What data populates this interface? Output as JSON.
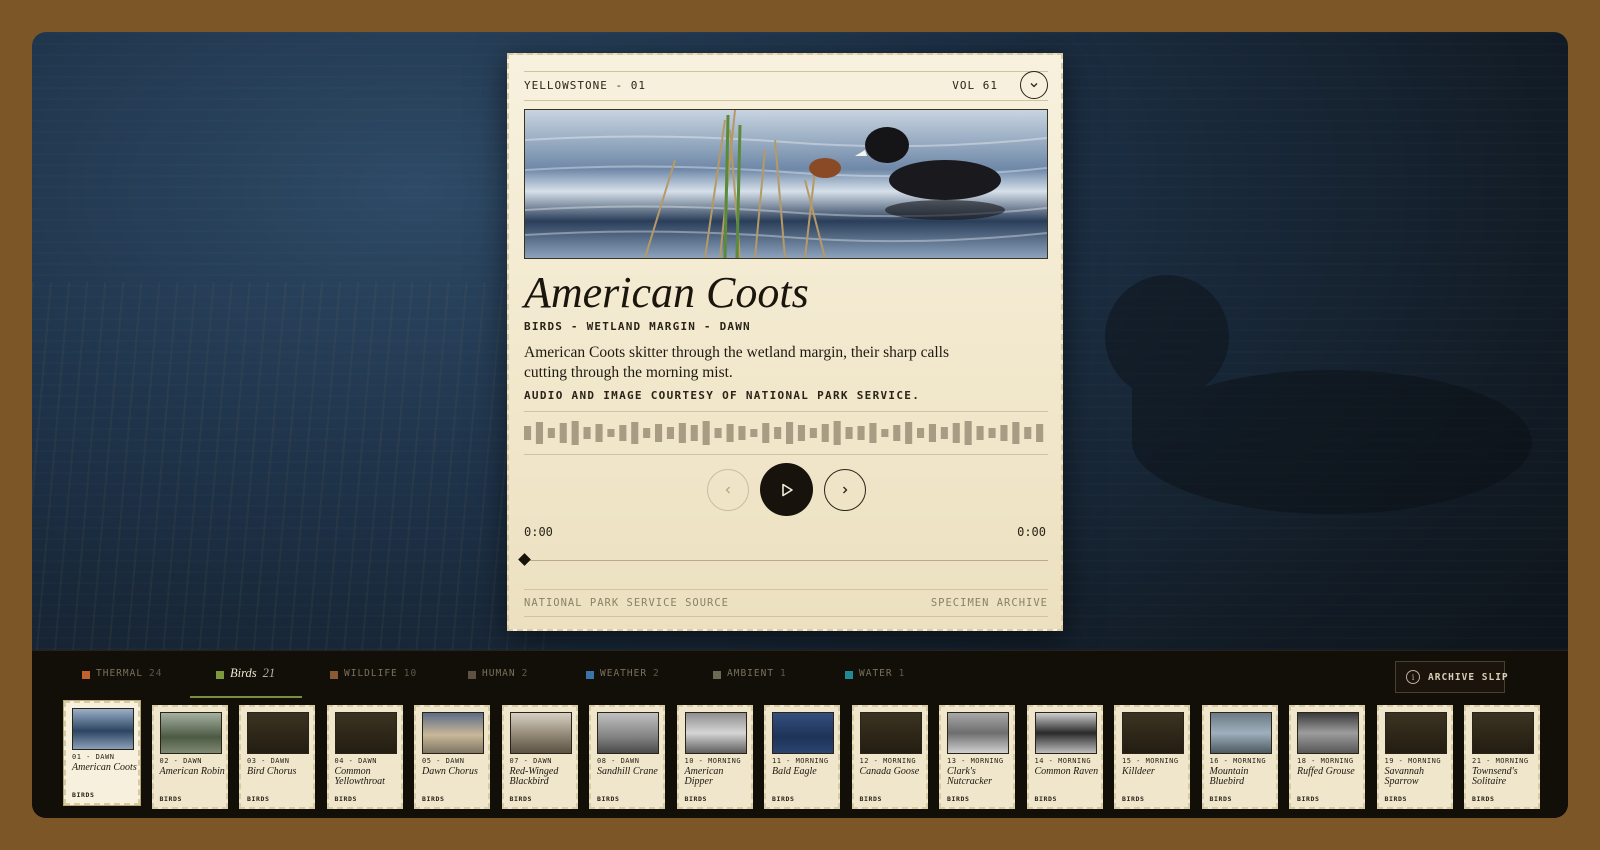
{
  "card": {
    "series": "YELLOWSTONE - 01",
    "volume": "VOL 61",
    "title": "American Coots",
    "meta": "BIRDS - WETLAND MARGIN - DAWN",
    "description": "American Coots skitter through the wetland margin, their sharp calls cutting through the morning mist.",
    "credit": "AUDIO AND IMAGE COURTESY OF NATIONAL PARK SERVICE.",
    "time_current": "0:00",
    "time_total": "0:00",
    "progress": 0,
    "footer_left": "NATIONAL PARK SERVICE SOURCE",
    "footer_right": "SPECIMEN ARCHIVE",
    "icons": {
      "collapse": "chevron-down-icon",
      "prev": "chevron-left-icon",
      "play": "play-icon",
      "next": "chevron-right-icon"
    }
  },
  "tabs": [
    {
      "label": "THERMAL",
      "count": "24",
      "color": "#c0622e",
      "active": false
    },
    {
      "label": "Birds",
      "count": "21",
      "color": "#7c9a3a",
      "active": true
    },
    {
      "label": "WILDLIFE",
      "count": "10",
      "color": "#8a5a34",
      "active": false
    },
    {
      "label": "HUMAN",
      "count": "2",
      "color": "#5e5140",
      "active": false
    },
    {
      "label": "WEATHER",
      "count": "2",
      "color": "#3a73a8",
      "active": false
    },
    {
      "label": "AMBIENT",
      "count": "1",
      "color": "#6b6a55",
      "active": false
    },
    {
      "label": "WATER",
      "count": "1",
      "color": "#1f8a95",
      "active": false
    }
  ],
  "archive_button": {
    "label": "ARCHIVE SLIP",
    "icon": "info-icon"
  },
  "slips": [
    {
      "num": "01 - DAWN",
      "name": "American Coots",
      "category": "BIRDS",
      "thumb": "photo",
      "active": true
    },
    {
      "num": "02 - DAWN",
      "name": "American Robin",
      "category": "BIRDS",
      "thumb": "photo"
    },
    {
      "num": "03 - DAWN",
      "name": "Bird Chorus",
      "category": "BIRDS",
      "thumb": "blank"
    },
    {
      "num": "04 - DAWN",
      "name": "Common Yellowthroat",
      "category": "BIRDS",
      "thumb": "blank"
    },
    {
      "num": "05 - DAWN",
      "name": "Dawn Chorus",
      "category": "BIRDS",
      "thumb": "photo"
    },
    {
      "num": "07 - DAWN",
      "name": "Red-Winged Blackbird",
      "category": "BIRDS",
      "thumb": "photo"
    },
    {
      "num": "08 - DAWN",
      "name": "Sandhill Crane",
      "category": "BIRDS",
      "thumb": "photo"
    },
    {
      "num": "10 - MORNING",
      "name": "American Dipper",
      "category": "BIRDS",
      "thumb": "photo"
    },
    {
      "num": "11 - MORNING",
      "name": "Bald Eagle",
      "category": "BIRDS",
      "thumb": "photo"
    },
    {
      "num": "12 - MORNING",
      "name": "Canada Goose",
      "category": "BIRDS",
      "thumb": "blank"
    },
    {
      "num": "13 - MORNING",
      "name": "Clark's Nutcracker",
      "category": "BIRDS",
      "thumb": "photo"
    },
    {
      "num": "14 - MORNING",
      "name": "Common Raven",
      "category": "BIRDS",
      "thumb": "photo"
    },
    {
      "num": "15 - MORNING",
      "name": "Killdeer",
      "category": "BIRDS",
      "thumb": "blank"
    },
    {
      "num": "16 - MORNING",
      "name": "Mountain Bluebird",
      "category": "BIRDS",
      "thumb": "photo"
    },
    {
      "num": "18 - MORNING",
      "name": "Ruffed Grouse",
      "category": "BIRDS",
      "thumb": "photo"
    },
    {
      "num": "19 - MORNING",
      "name": "Savannah Sparrow",
      "category": "BIRDS",
      "thumb": "blank"
    },
    {
      "num": "21 - MORNING",
      "name": "Townsend's Solitaire",
      "category": "BIRDS",
      "thumb": "blank"
    }
  ]
}
